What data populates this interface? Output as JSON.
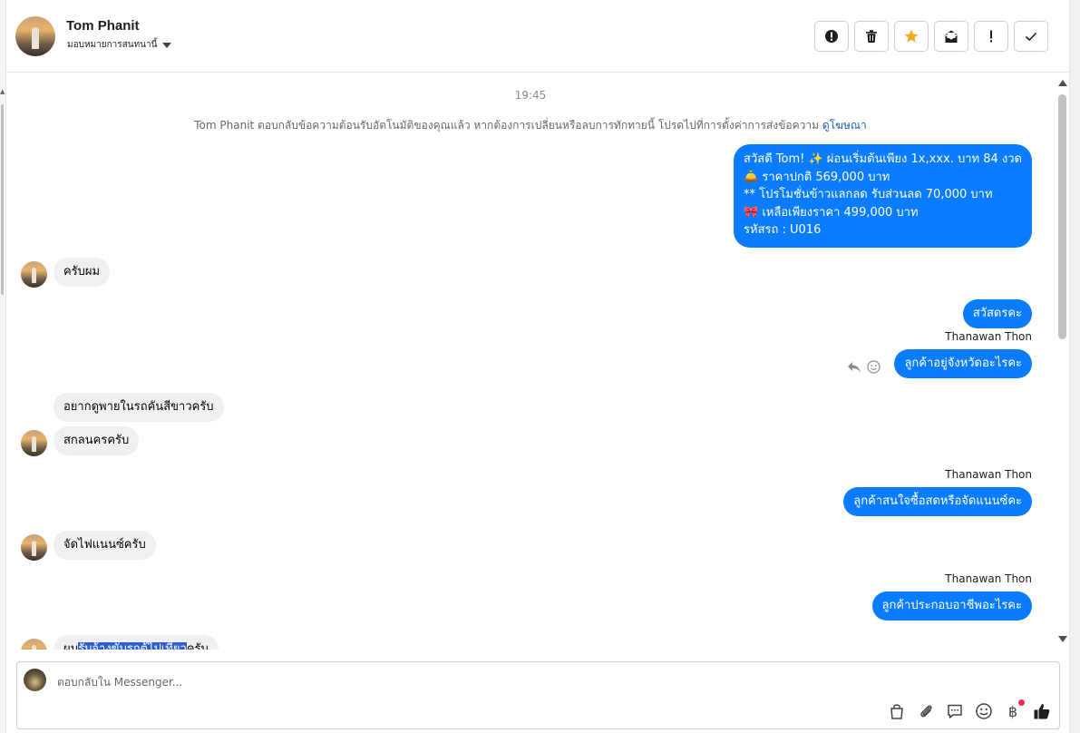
{
  "header": {
    "contact_name": "Tom Phanit",
    "assign_label": "มอบหมายการสนทนานี้",
    "actions": [
      {
        "icon": "spam-icon",
        "name": "spam-button"
      },
      {
        "icon": "trash-icon",
        "name": "delete-button"
      },
      {
        "icon": "star-icon",
        "name": "star-button"
      },
      {
        "icon": "mark-unread-icon",
        "name": "mark-unread-button"
      },
      {
        "icon": "exclamation-icon",
        "name": "follow-up-button"
      },
      {
        "icon": "check-icon",
        "name": "done-button"
      }
    ],
    "star_color": "#f5a623"
  },
  "chat": {
    "timestamp": "19:45",
    "notice": "Tom Phanit ตอบกลับข้อความต้อนรับอัตโนมัติของคุณแล้ว หากต้องการเปลี่ยนหรือลบการทักทายนี้ โปรดไปที่การตั้งค่าการส่งข้อความ",
    "notice_link": "ดูโฆษณา",
    "welcome_lines": [
      "สวัสดี Tom! ✨  ผ่อนเริ่มต้นเพียง 1x,xxx. บาท 84 งวด",
      "🛎️ ราคาปกติ 569,000 บาท",
      "** โปรโมชั่นข้าวแลกลด รับส่วนลด 70,000 บาท",
      "🎀  เหลือเพียงราคา 499,000 บาท",
      " รหัสรถ : U016"
    ],
    "msg_in_1": "ครับผม",
    "msg_out_1": "สวัสดรคะ",
    "sender_1": "Thanawan Thon",
    "msg_out_2": "ลูกค้าอยู่จังหวัดอะไรคะ",
    "msg_in_2": "อยากดูพายในรถคันสีขาวครับ",
    "msg_in_3": "สกลนครครับ",
    "sender_2": "Thanawan Thon",
    "msg_out_3": "ลูกค้าสนใจซื้อสดหรือจัดแนนซ์คะ",
    "msg_in_4": "จัดไฟแนนซ์ครับ",
    "sender_3": "Thanawan Thon",
    "msg_out_4": "ลูกค้าประกอบอาชีพอะไรคะ",
    "msg_in_5_pre": "ผม",
    "msg_in_5_sel": "รับจ้างขับรถตู้ไปเที่ยว",
    "msg_in_5_post": "ครับ",
    "bubble_out_color": "#0a7cff",
    "bubble_in_color": "#f0f0f0"
  },
  "composer": {
    "placeholder": "ตอบกลับใน Messenger..."
  }
}
